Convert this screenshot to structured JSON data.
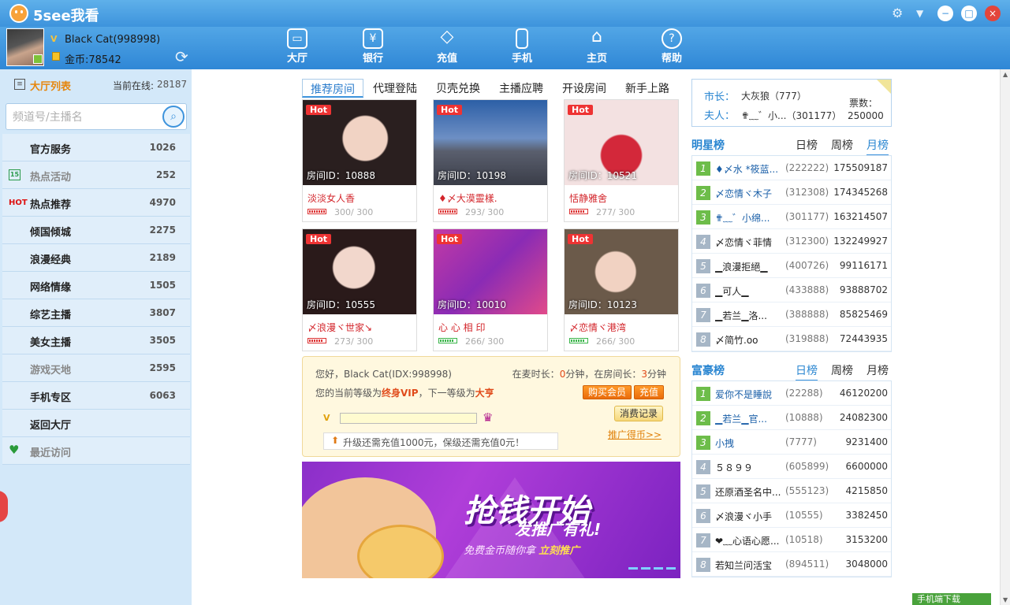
{
  "app": {
    "title": "5see我看",
    "icons": [
      "gear-icon",
      "dropdown-icon",
      "minimize-icon",
      "maximize-icon",
      "close-icon"
    ]
  },
  "user": {
    "name": "Black Cat(998998)",
    "gold": "金币:78542"
  },
  "nav": [
    {
      "label": "大厅",
      "icon": "monitor-icon"
    },
    {
      "label": "银行",
      "icon": "bank-icon"
    },
    {
      "label": "充值",
      "icon": "diamond-icon"
    },
    {
      "label": "手机",
      "icon": "phone-icon"
    },
    {
      "label": "主页",
      "icon": "home-icon"
    },
    {
      "label": "帮助",
      "icon": "help-icon"
    }
  ],
  "hall": {
    "title": "大厅列表",
    "online_label": "当前在线:",
    "online_count": "28187",
    "search_placeholder": "频道号/主播名",
    "items": [
      {
        "name": "官方服务",
        "count": "1026",
        "icon": ""
      },
      {
        "name": "热点活动",
        "count": "252",
        "icon": "calendar-icon"
      },
      {
        "name": "热点推荐",
        "count": "4970",
        "icon": "hot-icon"
      },
      {
        "name": "倾国倾城",
        "count": "2275",
        "icon": ""
      },
      {
        "name": "浪漫经典",
        "count": "2189",
        "icon": ""
      },
      {
        "name": "网络情缘",
        "count": "1505",
        "icon": ""
      },
      {
        "name": "综艺主播",
        "count": "3807",
        "icon": ""
      },
      {
        "name": "美女主播",
        "count": "3505",
        "icon": ""
      },
      {
        "name": "游戏天地",
        "count": "2595",
        "icon": ""
      },
      {
        "name": "手机专区",
        "count": "6063",
        "icon": ""
      },
      {
        "name": "返回大厅",
        "count": "",
        "icon": ""
      },
      {
        "name": "最近访问",
        "count": "",
        "icon": "heart-icon"
      }
    ],
    "hot_label": "HOT",
    "calendar_label": "15"
  },
  "room_tabs": [
    "推荐房间",
    "代理登陆",
    "贝壳兑换",
    "主播应聘",
    "开设房间",
    "新手上路"
  ],
  "rooms": [
    {
      "id": "房间ID：10888",
      "name": "淡淡女人香",
      "cap": "300/ 300",
      "hot": "Hot",
      "fill": 1.0
    },
    {
      "id": "房间ID：10198",
      "name": "♦〆大漠靈樣.",
      "cap": "293/ 300",
      "hot": "Hot",
      "fill": 0.98
    },
    {
      "id": "房间ID：10521",
      "name": "恬静雅舍",
      "cap": "277/ 300",
      "hot": "Hot",
      "fill": 0.92
    },
    {
      "id": "房间ID：10555",
      "name": "〆浪漫ヾ世家↘",
      "cap": "273/ 300",
      "hot": "Hot",
      "fill": 0.91
    },
    {
      "id": "房间ID：10010",
      "name": "心 心 相 印",
      "cap": "266/ 300",
      "hot": "Hot",
      "fill": 0.89
    },
    {
      "id": "房间ID：10123",
      "name": "〆恋情ヾ港湾",
      "cap": "266/ 300",
      "hot": "Hot",
      "fill": 0.89
    }
  ],
  "info": {
    "greeting": "您好，Black Cat(IDX:998998)",
    "mic_prefix": "在麦时长：",
    "mic_value": "0",
    "mic_mid": "分钟，在房间长：",
    "room_value": "3",
    "mic_suffix": "分钟",
    "level_prefix": "您的当前等级为",
    "level_current": "终身VIP",
    "level_mid": "，下一等级为",
    "level_next": "大亨",
    "buy_vip": "购买会员",
    "recharge": "充值",
    "history": "消费记录",
    "promo": "推广得币>>",
    "upgrade_text": "升级还需充值1000元，保级还需充值0元！",
    "progress": 0.0
  },
  "banner": {
    "title": "抢钱开始",
    "subtitle": "发推广有礼!",
    "sub_prefix": "免费金币随你拿 ",
    "sub_emph": "立刻推广"
  },
  "mayor": {
    "mayor_label": "市长：",
    "mayor_value": "大灰狼（777）",
    "wife_label": "夫人：",
    "wife_value": "✟﹏゛小...（301177）",
    "votes_label": "票数：",
    "votes_value": "250000"
  },
  "star_rank": {
    "title": "明星榜",
    "tabs": [
      "日榜",
      "周榜",
      "月榜"
    ],
    "active": 2,
    "rows": [
      {
        "n": "1",
        "name": "♦〆水 *筱蓝...",
        "id": "(222222)",
        "score": "175509187"
      },
      {
        "n": "2",
        "name": "〆恋情ヾ木子",
        "id": "(312308)",
        "score": "174345268"
      },
      {
        "n": "3",
        "name": "✟﹏゛小绵...",
        "id": "(301177)",
        "score": "163214507"
      },
      {
        "n": "4",
        "name": "〆恋情ヾ菲情",
        "id": "(312300)",
        "score": "132249927"
      },
      {
        "n": "5",
        "name": "▁浪漫拒絕▁",
        "id": "(400726)",
        "score": "99116171"
      },
      {
        "n": "6",
        "name": "▁可人▁",
        "id": "(433888)",
        "score": "93888702"
      },
      {
        "n": "7",
        "name": "▁若兰▁洛...",
        "id": "(388888)",
        "score": "85825469"
      },
      {
        "n": "8",
        "name": "〆简竹.oo",
        "id": "(319888)",
        "score": "72443935"
      }
    ]
  },
  "rich_rank": {
    "title": "富豪榜",
    "tabs": [
      "日榜",
      "周榜",
      "月榜"
    ],
    "active": 0,
    "rows": [
      {
        "n": "1",
        "name": "爱你不是睡說",
        "id": "(22288)",
        "score": "46120200"
      },
      {
        "n": "2",
        "name": "▁若兰▁官...",
        "id": "(10888)",
        "score": "24082300"
      },
      {
        "n": "3",
        "name": "小拽",
        "id": "(7777)",
        "score": "9231400"
      },
      {
        "n": "4",
        "name": "５８９９",
        "id": "(605899)",
        "score": "6600000"
      },
      {
        "n": "5",
        "name": "还原酒圣名中...",
        "id": "(555123)",
        "score": "4215850"
      },
      {
        "n": "6",
        "name": "〆浪漫ヾ小手",
        "id": "(10555)",
        "score": "3382450"
      },
      {
        "n": "7",
        "name": "❤﹏心语心愿...",
        "id": "(10518)",
        "score": "3153200"
      },
      {
        "n": "8",
        "name": "若知兰问活宝",
        "id": "(894511)",
        "score": "3048000"
      }
    ]
  },
  "mobile_download": "手机端下载"
}
